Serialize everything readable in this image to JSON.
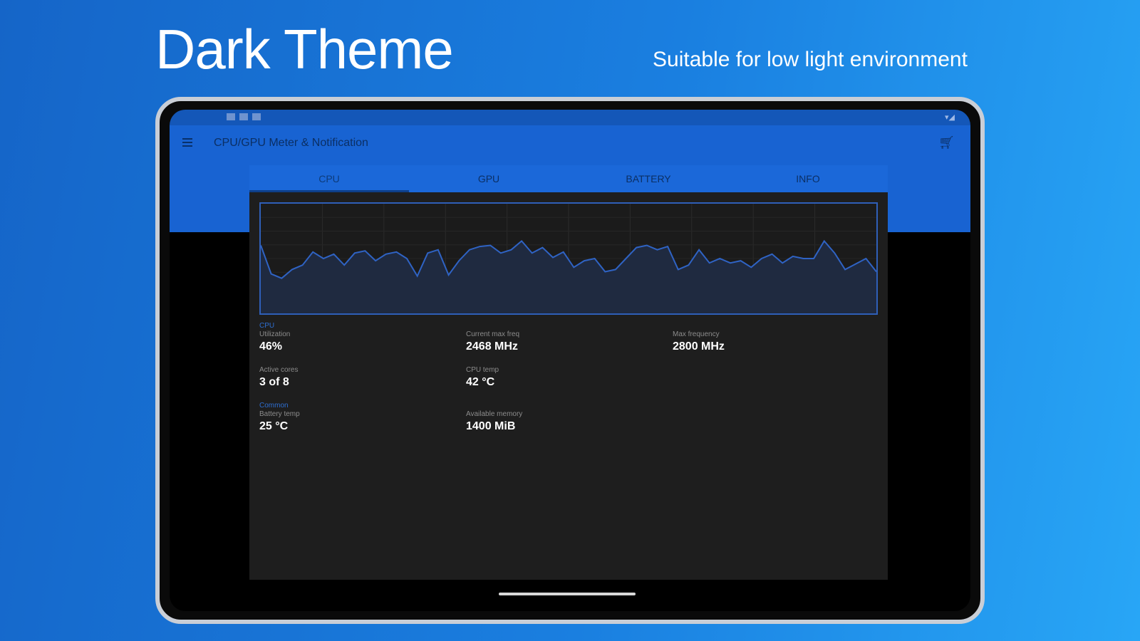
{
  "promo": {
    "title": "Dark Theme",
    "subtitle": "Suitable for low light environment"
  },
  "app": {
    "title": "CPU/GPU Meter & Notification",
    "tabs": [
      "CPU",
      "GPU",
      "BATTERY",
      "INFO"
    ],
    "active_tab": "CPU"
  },
  "chart_data": {
    "type": "area",
    "title": "",
    "xlabel": "",
    "ylabel": "",
    "grid": true,
    "x": [
      0,
      1,
      2,
      3,
      4,
      5,
      6,
      7,
      8,
      9,
      10,
      11,
      12,
      13,
      14,
      15,
      16,
      17,
      18,
      19,
      20,
      21,
      22,
      23,
      24,
      25,
      26,
      27,
      28,
      29,
      30,
      31,
      32,
      33,
      34,
      35,
      36,
      37,
      38,
      39,
      40,
      41,
      42,
      43,
      44,
      45,
      46,
      47,
      48,
      49,
      50,
      51,
      52,
      53,
      54,
      55,
      56,
      57,
      58,
      59
    ],
    "ylim": [
      0,
      100
    ],
    "series": [
      {
        "values": [
          62,
          36,
          32,
          40,
          44,
          56,
          50,
          54,
          44,
          55,
          57,
          48,
          54,
          56,
          50,
          34,
          55,
          58,
          35,
          48,
          58,
          61,
          62,
          55,
          58,
          66,
          55,
          60,
          51,
          56,
          42,
          48,
          50,
          38,
          40,
          50,
          60,
          62,
          58,
          61,
          40,
          44,
          58,
          46,
          50,
          46,
          48,
          42,
          50,
          54,
          46,
          52,
          50,
          50,
          66,
          55,
          40,
          45,
          50,
          38
        ]
      }
    ]
  },
  "stats": {
    "section_cpu": "CPU",
    "utilization_label": "Utilization",
    "utilization_value": "46%",
    "current_freq_label": "Current max freq",
    "current_freq_value": "2468 MHz",
    "max_freq_label": "Max frequency",
    "max_freq_value": "2800 MHz",
    "active_cores_label": "Active cores",
    "active_cores_value": "3 of 8",
    "cpu_temp_label": "CPU temp",
    "cpu_temp_value": "42 °C",
    "section_common": "Common",
    "battery_temp_label": "Battery temp",
    "battery_temp_value": "25 °C",
    "available_memory_label": "Available memory",
    "available_memory_value": "1400 MiB"
  },
  "colors": {
    "accent": "#1863d2",
    "panel": "#1e1e1e",
    "chart_line": "#2f63c4"
  }
}
